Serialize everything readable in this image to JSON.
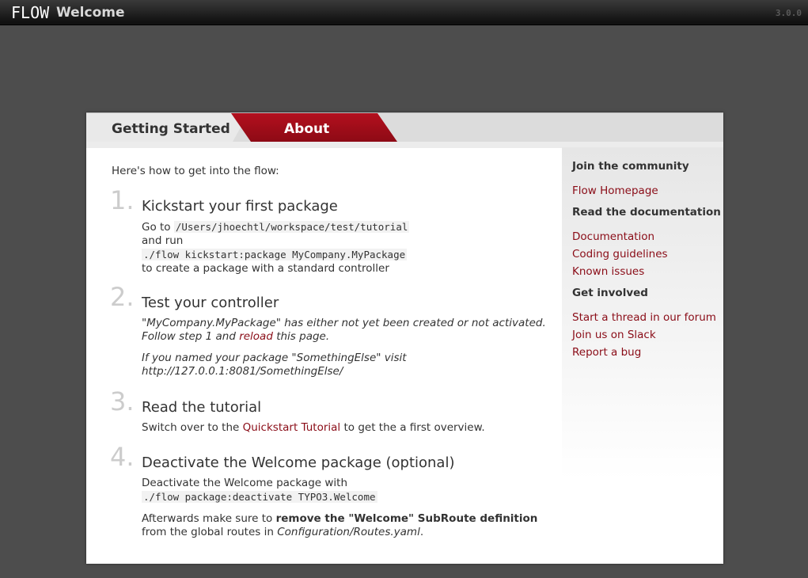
{
  "topbar": {
    "logo": "FLOW",
    "title": "Welcome",
    "version": "3.0.0"
  },
  "tabs": [
    {
      "label": "Getting Started",
      "active": true
    },
    {
      "label": "About",
      "active": false
    }
  ],
  "intro": "Here's how to get into the flow:",
  "steps": [
    {
      "number": "1.",
      "title": "Kickstart your first package",
      "line1_prefix": "Go to",
      "path": "/Users/jhoechtl/workspace/test/tutorial",
      "line2": "and run",
      "command": "./flow kickstart:package MyCompany.MyPackage",
      "line3": "to create a package with a standard controller"
    },
    {
      "number": "2.",
      "title": "Test your controller",
      "notice": "\"MyCompany.MyPackage\" has either not yet been created or not activated.",
      "follow_prefix": "Follow step 1 and",
      "reload_link": "reload",
      "follow_suffix": "this page.",
      "named_prefix": "If you named your package \"SomethingElse\" visit",
      "url": "http://127.0.0.1:8081/SomethingElse/"
    },
    {
      "number": "3.",
      "title": "Read the tutorial",
      "prefix": "Switch over to the",
      "tutorial_link": "Quickstart Tutorial",
      "suffix": "to get the a first overview."
    },
    {
      "number": "4.",
      "title": "Deactivate the Welcome package (optional)",
      "line1": "Deactivate the Welcome package with",
      "command": "./flow package:deactivate TYPO3.Welcome",
      "after_prefix": "Afterwards make sure to",
      "after_bold": "remove the \"Welcome\" SubRoute definition",
      "after_mid": "from the global routes in",
      "after_file": "Configuration/Routes.yaml",
      "after_end": "."
    }
  ],
  "sidebar": {
    "groups": [
      {
        "heading": "Join the community",
        "links": [
          "Flow Homepage"
        ]
      },
      {
        "heading": "Read the documentation",
        "links": [
          "Documentation",
          "Coding guidelines",
          "Known issues"
        ]
      },
      {
        "heading": "Get involved",
        "links": [
          "Start a thread in our forum",
          "Join us on Slack",
          "Report a bug"
        ]
      }
    ]
  },
  "colors": {
    "accent": "#8a0c17",
    "tab_active": "#b3101e",
    "background": "#4d4d4d"
  }
}
